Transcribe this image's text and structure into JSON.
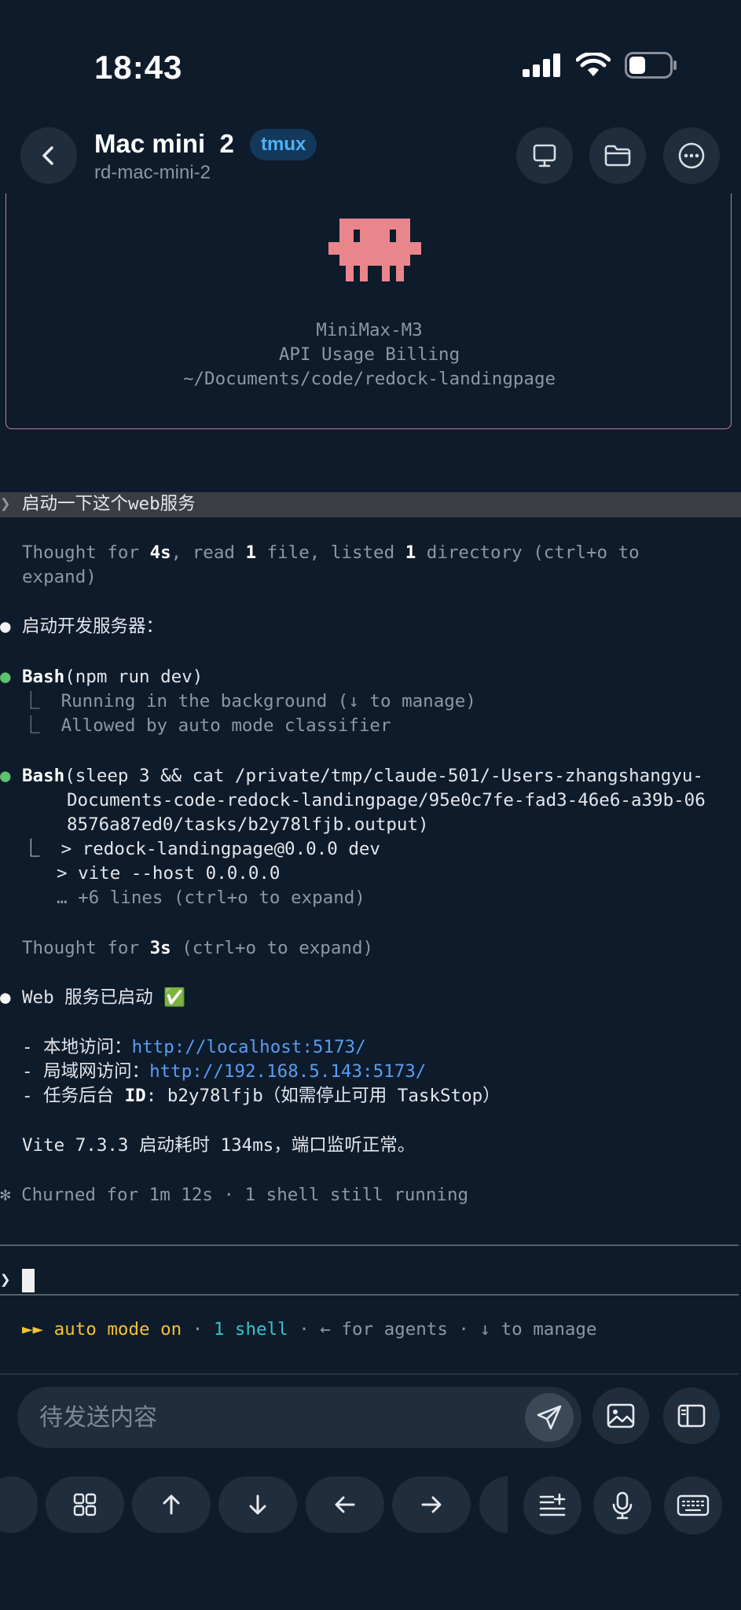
{
  "status_bar": {
    "time": "18:43"
  },
  "header": {
    "title": "Mac mini  2",
    "badge": "tmux",
    "subtitle": "rd-mac-mini-2"
  },
  "terminal": {
    "banner": {
      "model": "MiniMax-M3",
      "plan": "API Usage Billing",
      "path": "~/Documents/code/redock-landingpage"
    },
    "user_prompt": {
      "marker": "❯",
      "text": "启动一下这个web服务"
    },
    "thought1": {
      "a": "Thought for ",
      "b": "4s",
      "c": ", read ",
      "d": "1",
      "e": " file, listed ",
      "f": "1",
      "g": " directory (ctrl+o to",
      "h": "expand)"
    },
    "msg1": {
      "bullet": "●",
      "text": "启动开发服务器："
    },
    "bash1": {
      "bullet": "●",
      "tool": "Bash",
      "args": "(npm run dev)",
      "lines": [
        "⎿  Running in the background (↓ to manage)",
        "⎿  Allowed by auto mode classifier"
      ]
    },
    "bash2": {
      "bullet": "●",
      "tool": "Bash",
      "args": [
        "(sleep 3 && cat /private/tmp/claude-501/-Users-zhangshangyu-",
        "Documents-code-redock-landingpage/95e0c7fe-fad3-46e6-a39b-06",
        "8576a87ed0/tasks/b2y78lfjb.output)"
      ],
      "output": [
        "⎿  > redock-landingpage@0.0.0 dev",
        "> vite --host 0.0.0.0",
        "… +6 lines (ctrl+o to expand)"
      ]
    },
    "thought2": {
      "a": "Thought for ",
      "b": "3s",
      "c": " (ctrl+o to expand)"
    },
    "msg2": {
      "bullet": "●",
      "text": "Web 服务已启动 ✅"
    },
    "list": {
      "local_label": "- 本地访问：",
      "local_url": "http://localhost:5173/",
      "lan_label": "- 局域网访问：",
      "lan_url": "http://192.168.5.143:5173/",
      "task_label": "- 任务后台 ",
      "task_id_label": "ID",
      "task_value": ": b2y78lfjb（如需停止可用 TaskStop）"
    },
    "vite_line": "Vite 7.3.3 启动耗时 134ms，端口监听正常。",
    "churn": {
      "star": "✻",
      "text": " Churned for 1m 12s · 1 shell still running"
    },
    "input_marker": "❯",
    "footer": {
      "arrows": "►► ",
      "mode": "auto mode on",
      "sep1": " · ",
      "shell": "1 shell",
      "rest": " · ← for agents · ↓ to manage"
    }
  },
  "composer": {
    "placeholder": "待发送内容"
  },
  "keys": [
    "grid",
    "up",
    "down",
    "left",
    "right"
  ],
  "colors": {
    "background": "#0e1b2b",
    "link": "#5b9cf0",
    "accent_yellow": "#f2c230",
    "accent_cyan": "#34c4c9",
    "banner_border": "#c4828c",
    "mascot": "#e8868c"
  }
}
